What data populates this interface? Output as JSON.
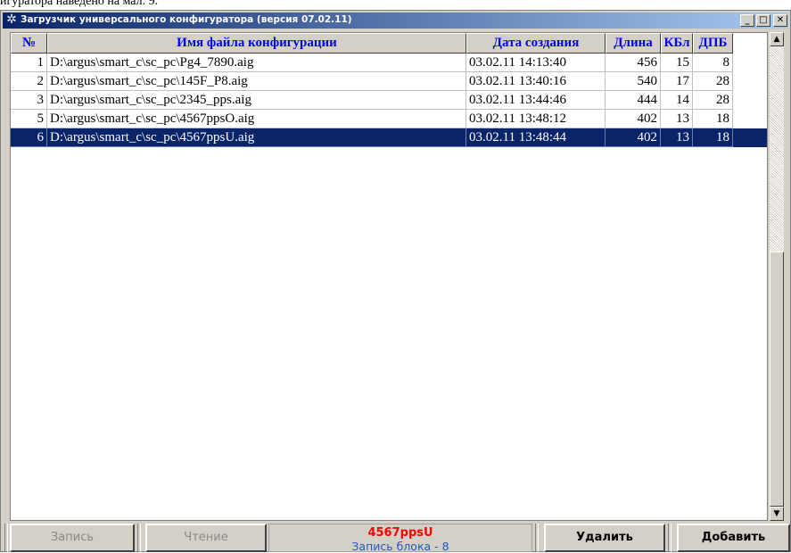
{
  "context_text": "игуратора наведено на мал. 9.",
  "window": {
    "title": "Загрузчик универсального конфигуратора (версия 07.02.11)",
    "min_icon": "minimize-icon",
    "max_icon": "maximize-icon",
    "close_icon": "close-icon"
  },
  "table": {
    "columns": [
      "№",
      "Имя файла конфигурации",
      "Дата создания",
      "Длина",
      "КБл",
      "ДПБ"
    ],
    "rows": [
      {
        "num": "1",
        "file": "D:\\argus\\smart_c\\sc_pc\\Pg4_7890.aig",
        "date": "03.02.11 14:13:40",
        "len": "456",
        "kbl": "15",
        "dpb": "8"
      },
      {
        "num": "2",
        "file": "D:\\argus\\smart_c\\sc_pc\\145F_P8.aig",
        "date": "03.02.11 13:40:16",
        "len": "540",
        "kbl": "17",
        "dpb": "28"
      },
      {
        "num": "3",
        "file": "D:\\argus\\smart_c\\sc_pc\\2345_pps.aig",
        "date": "03.02.11 13:44:46",
        "len": "444",
        "kbl": "14",
        "dpb": "28"
      },
      {
        "num": "5",
        "file": "D:\\argus\\smart_c\\sc_pc\\4567ppsO.aig",
        "date": "03.02.11 13:48:12",
        "len": "402",
        "kbl": "13",
        "dpb": "18"
      },
      {
        "num": "6",
        "file": "D:\\argus\\smart_c\\sc_pc\\4567ppsU.aig",
        "date": "03.02.11 13:48:44",
        "len": "402",
        "kbl": "13",
        "dpb": "18"
      }
    ],
    "selected_row": 4
  },
  "buttons": {
    "write": "Запись",
    "read": "Чтение",
    "delete": "Удалить",
    "add": "Добавить"
  },
  "status": {
    "filename": "4567ppsU",
    "message": "Запись блока - 8"
  },
  "colors": {
    "selection": "#0a246a",
    "header_text": "#0000ff",
    "status_filename": "#ff0000",
    "status_message": "#1f5ab8"
  }
}
